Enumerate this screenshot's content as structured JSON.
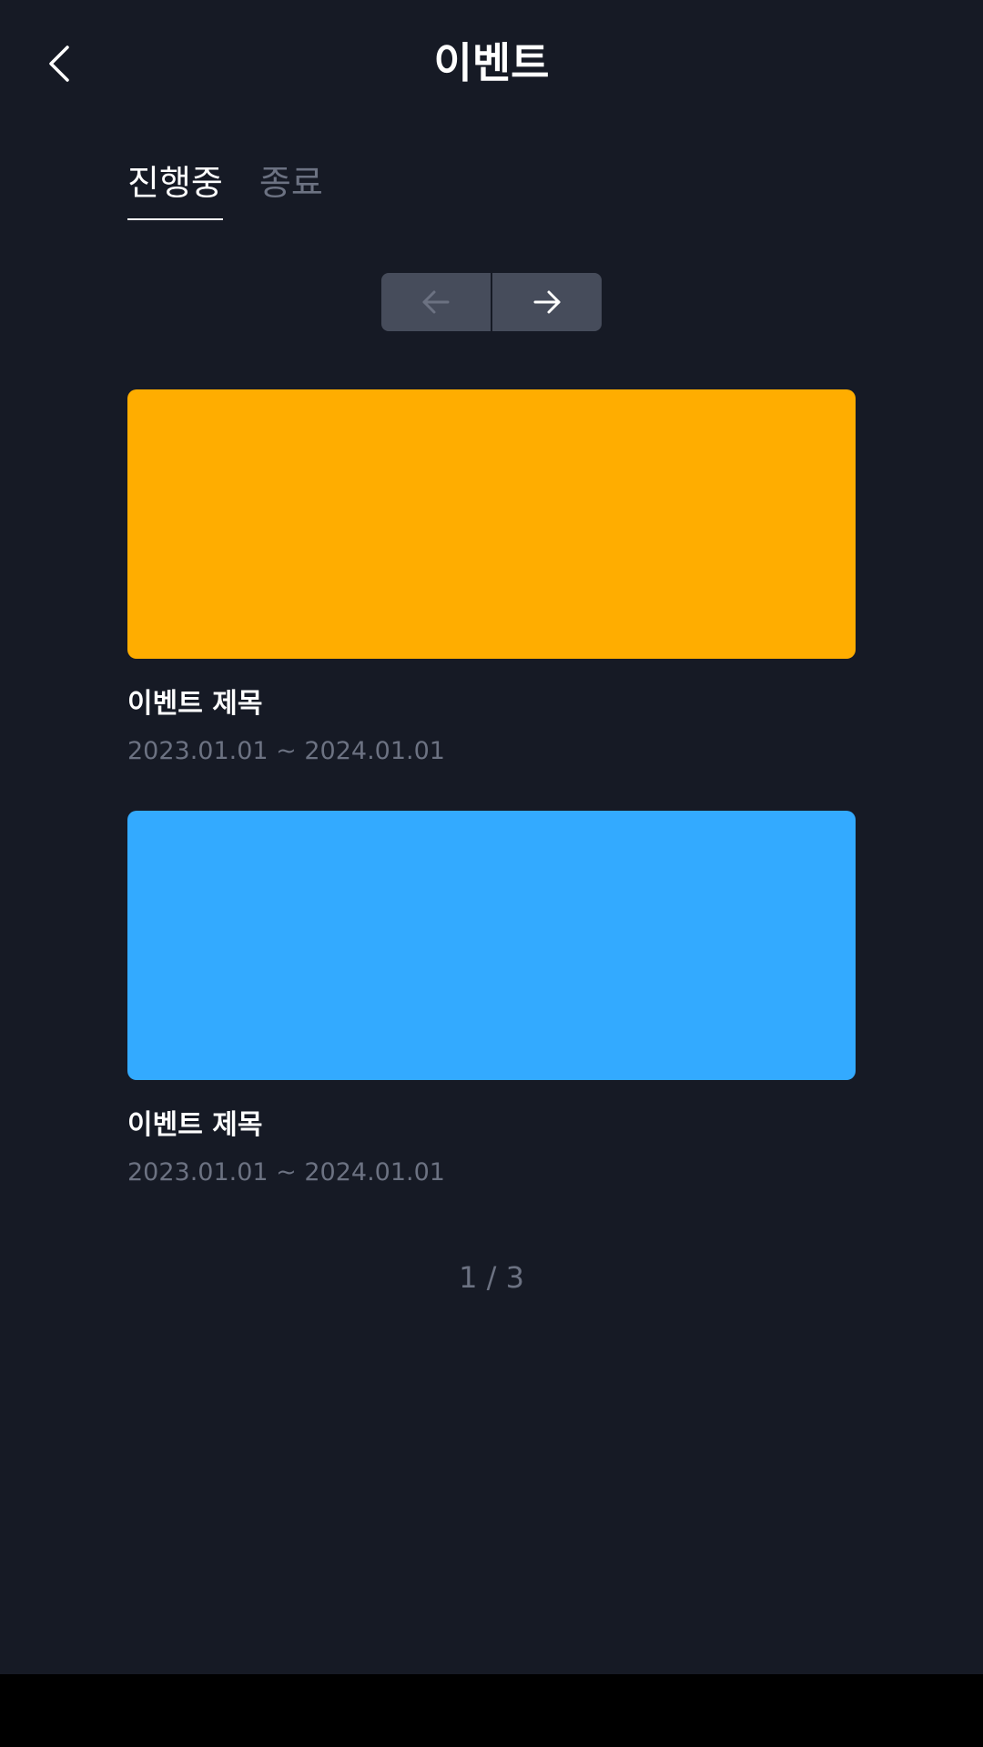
{
  "header": {
    "title": "이벤트",
    "back_icon": "chevron-left-icon"
  },
  "tabs": [
    {
      "label": "진행중",
      "active": true
    },
    {
      "label": "종료",
      "active": false
    }
  ],
  "pager": {
    "prev_icon": "arrow-left-icon",
    "next_icon": "arrow-right-icon",
    "prev_enabled": false,
    "next_enabled": true
  },
  "events": [
    {
      "title": "이벤트 제목",
      "date_range": "2023.01.01 ~ 2024.01.01",
      "banner_color": "#ffad00"
    },
    {
      "title": "이벤트 제목",
      "date_range": "2023.01.01 ~ 2024.01.01",
      "banner_color": "#33aaff"
    }
  ],
  "pagination": {
    "text": "1 / 3",
    "current": 1,
    "total": 3
  },
  "colors": {
    "background": "#161a25",
    "muted_text": "#6c7282",
    "button_bg": "#464c5b"
  }
}
